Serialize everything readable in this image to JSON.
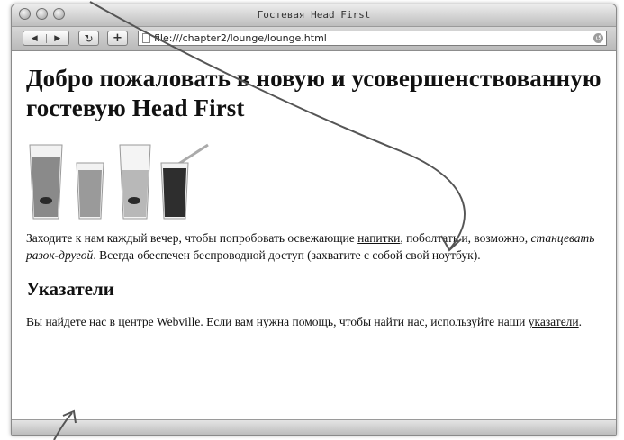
{
  "window": {
    "title": "Гостевая Head First",
    "url": "file:///chapter2/lounge/lounge.html"
  },
  "toolbar": {
    "back_label": "◀",
    "forward_label": "▶",
    "reload_label": "↻",
    "add_label": "+"
  },
  "page": {
    "heading": "Добро пожаловать в новую и усовершенствованную гостевую Head First",
    "intro_before_link": "Заходите к нам каждый вечер, чтобы попробовать освежающие ",
    "intro_link": "напитки",
    "intro_after_link": ", поболтать и, возможно, ",
    "intro_emphasis": "станцевать разок-другой",
    "intro_end": ". Всегда обеспечен беспроводной доступ (захватите с собой свой ноутбук).",
    "directions_heading": "Указатели",
    "directions_before_link": "Вы найдете нас в центре Webville. Если вам нужна помощь, чтобы найти нас, используйте наши ",
    "directions_link": "указатели",
    "directions_end": "."
  },
  "colors": {
    "drink1": "#8a8a8a",
    "drink2": "#9a9a9a",
    "drink3": "#b8b8b8",
    "drink4": "#2e2e2e"
  }
}
